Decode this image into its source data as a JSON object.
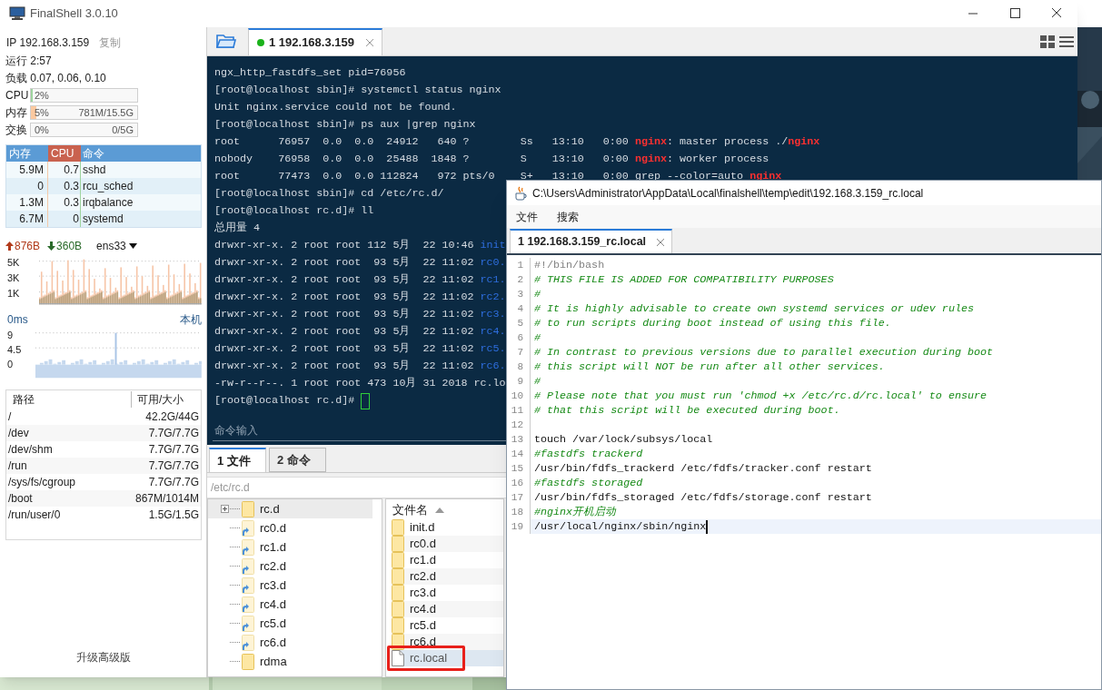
{
  "window": {
    "title": "FinalShell 3.0.10"
  },
  "sidebar": {
    "ip": "IP 192.168.3.159",
    "copy": "复制",
    "uptime": "运行 2:57",
    "load": "负载 0.07, 0.06, 0.10",
    "meters": [
      {
        "kind": "cpu",
        "label": "CPU",
        "reading": "2%",
        "level": 0.02
      },
      {
        "kind": "mem",
        "label": "内存",
        "reading": "5%",
        "detail": "781M/15.5G",
        "level": 0.05
      },
      {
        "kind": "swap",
        "label": "交换",
        "reading": "0%",
        "detail": "0/5G",
        "level": 0
      }
    ],
    "processes": {
      "columns": [
        "内存",
        "CPU",
        "命令"
      ],
      "rows": [
        [
          "5.9M",
          "0.7",
          "sshd"
        ],
        [
          "0",
          "0.3",
          "rcu_sched"
        ],
        [
          "1.3M",
          "0.3",
          "irqbalance"
        ],
        [
          "6.7M",
          "0",
          "systemd"
        ]
      ]
    },
    "network": {
      "up": "876B",
      "down": "360B",
      "interface": "ens33",
      "yticks": [
        "5K",
        "3K",
        "1K"
      ]
    },
    "latency": {
      "value": "0ms",
      "host": "本机",
      "yticks": [
        "9",
        "4.5",
        "0"
      ]
    },
    "disks": {
      "columns": [
        "路径",
        "可用/大小"
      ],
      "rows": [
        [
          "/",
          "42.2G/44G"
        ],
        [
          "/dev",
          "7.7G/7.7G"
        ],
        [
          "/dev/shm",
          "7.7G/7.7G"
        ],
        [
          "/run",
          "7.7G/7.7G"
        ],
        [
          "/sys/fs/cgroup",
          "7.7G/7.7G"
        ],
        [
          "/boot",
          "867M/1014M"
        ],
        [
          "/run/user/0",
          "1.5G/1.5G"
        ]
      ]
    },
    "upgrade": "升级高级版"
  },
  "session_tabs": [
    {
      "label": "1 192.168.3.159",
      "connected": true,
      "selected": true
    }
  ],
  "terminal": {
    "lines": [
      {
        "segments": [
          {
            "kind": "plain",
            "text": "ngx_http_fastdfs_set pid=76956"
          }
        ]
      },
      {
        "segments": [
          {
            "kind": "plain",
            "text": "[root@localhost sbin]# systemctl status nginx"
          }
        ]
      },
      {
        "segments": [
          {
            "kind": "plain",
            "text": "Unit nginx.service could not be found."
          }
        ]
      },
      {
        "segments": [
          {
            "kind": "plain",
            "text": "[root@localhost sbin]# ps aux |grep nginx"
          }
        ]
      },
      {
        "segments": [
          {
            "kind": "plain",
            "text": "root      76957  0.0  0.0  24912   640 ?        Ss   13:10   0:00 "
          },
          {
            "kind": "red",
            "text": "nginx"
          },
          {
            "kind": "plain",
            "text": ": master process ./"
          },
          {
            "kind": "red",
            "text": "nginx"
          }
        ]
      },
      {
        "segments": [
          {
            "kind": "plain",
            "text": "nobody    76958  0.0  0.0  25488  1848 ?        S    13:10   0:00 "
          },
          {
            "kind": "red",
            "text": "nginx"
          },
          {
            "kind": "plain",
            "text": ": worker process"
          }
        ]
      },
      {
        "segments": [
          {
            "kind": "plain",
            "text": "root      77473  0.0  0.0 112824   972 pts/0    S+   13:10   0:00 grep --color=auto "
          },
          {
            "kind": "red",
            "text": "nginx"
          }
        ]
      },
      {
        "segments": [
          {
            "kind": "plain",
            "text": "[root@localhost sbin]# cd /etc/rc.d/"
          }
        ]
      },
      {
        "segments": [
          {
            "kind": "plain",
            "text": "[root@localhost rc.d]# ll"
          }
        ]
      },
      {
        "segments": [
          {
            "kind": "plain",
            "text": "总用量 4"
          }
        ]
      },
      {
        "segments": [
          {
            "kind": "plain",
            "text": "drwxr-xr-x. 2 root root 112 5月  22 10:46 "
          },
          {
            "kind": "blue",
            "text": "init"
          }
        ]
      },
      {
        "segments": [
          {
            "kind": "plain",
            "text": "drwxr-xr-x. 2 root root  93 5月  22 11:02 "
          },
          {
            "kind": "blue",
            "text": "rc0."
          }
        ]
      },
      {
        "segments": [
          {
            "kind": "plain",
            "text": "drwxr-xr-x. 2 root root  93 5月  22 11:02 "
          },
          {
            "kind": "blue",
            "text": "rc1."
          }
        ]
      },
      {
        "segments": [
          {
            "kind": "plain",
            "text": "drwxr-xr-x. 2 root root  93 5月  22 11:02 "
          },
          {
            "kind": "blue",
            "text": "rc2."
          }
        ]
      },
      {
        "segments": [
          {
            "kind": "plain",
            "text": "drwxr-xr-x. 2 root root  93 5月  22 11:02 "
          },
          {
            "kind": "blue",
            "text": "rc3."
          }
        ]
      },
      {
        "segments": [
          {
            "kind": "plain",
            "text": "drwxr-xr-x. 2 root root  93 5月  22 11:02 "
          },
          {
            "kind": "blue",
            "text": "rc4."
          }
        ]
      },
      {
        "segments": [
          {
            "kind": "plain",
            "text": "drwxr-xr-x. 2 root root  93 5月  22 11:02 "
          },
          {
            "kind": "blue",
            "text": "rc5."
          }
        ]
      },
      {
        "segments": [
          {
            "kind": "plain",
            "text": "drwxr-xr-x. 2 root root  93 5月  22 11:02 "
          },
          {
            "kind": "blue",
            "text": "rc6."
          }
        ]
      },
      {
        "segments": [
          {
            "kind": "plain",
            "text": "-rw-r--r--. 1 root root 473 10月 31 2018 rc.lo"
          }
        ]
      },
      {
        "segments": [
          {
            "kind": "plain",
            "text": "[root@localhost rc.d]# "
          }
        ]
      }
    ],
    "input_placeholder": "命令输入"
  },
  "bottom_tabs": [
    {
      "label": "1 文件",
      "selected": true
    },
    {
      "label": "2 命令",
      "selected": false
    }
  ],
  "path": "/etc/rc.d",
  "tree": [
    {
      "name": "rc.d",
      "kind": "folder",
      "expandable": true,
      "selected": true
    },
    {
      "name": "rc0.d",
      "kind": "link-folder",
      "expandable": false,
      "selected": false
    },
    {
      "name": "rc1.d",
      "kind": "link-folder",
      "expandable": false,
      "selected": false
    },
    {
      "name": "rc2.d",
      "kind": "link-folder",
      "expandable": false,
      "selected": false
    },
    {
      "name": "rc3.d",
      "kind": "link-folder",
      "expandable": false,
      "selected": false
    },
    {
      "name": "rc4.d",
      "kind": "link-folder",
      "expandable": false,
      "selected": false
    },
    {
      "name": "rc5.d",
      "kind": "link-folder",
      "expandable": false,
      "selected": false
    },
    {
      "name": "rc6.d",
      "kind": "link-folder",
      "expandable": false,
      "selected": false
    },
    {
      "name": "rdma",
      "kind": "folder",
      "expandable": false,
      "selected": false
    }
  ],
  "files": {
    "column": "文件名",
    "rows": [
      {
        "name": "init.d",
        "kind": "folder",
        "selected": false,
        "marked": false
      },
      {
        "name": "rc0.d",
        "kind": "folder",
        "selected": false,
        "marked": false
      },
      {
        "name": "rc1.d",
        "kind": "folder",
        "selected": false,
        "marked": false
      },
      {
        "name": "rc2.d",
        "kind": "folder",
        "selected": false,
        "marked": false
      },
      {
        "name": "rc3.d",
        "kind": "folder",
        "selected": false,
        "marked": false
      },
      {
        "name": "rc4.d",
        "kind": "folder",
        "selected": false,
        "marked": false
      },
      {
        "name": "rc5.d",
        "kind": "folder",
        "selected": false,
        "marked": false
      },
      {
        "name": "rc6.d",
        "kind": "folder",
        "selected": false,
        "marked": false
      },
      {
        "name": "rc.local",
        "kind": "file",
        "selected": true,
        "marked": true
      }
    ]
  },
  "editor": {
    "title": "C:\\Users\\Administrator\\AppData\\Local\\finalshell\\temp\\edit\\192.168.3.159_rc.local",
    "menu": [
      "文件",
      "搜索"
    ],
    "tabs": [
      {
        "label": "1 192.168.3.159_rc.local",
        "selected": true
      }
    ],
    "lines": [
      {
        "number": "1",
        "kind": "shebang",
        "text": "#!/bin/bash",
        "current": false
      },
      {
        "number": "2",
        "kind": "comment",
        "text": "# THIS FILE IS ADDED FOR COMPATIBILITY PURPOSES",
        "current": false
      },
      {
        "number": "3",
        "kind": "comment",
        "text": "#",
        "current": false
      },
      {
        "number": "4",
        "kind": "comment",
        "text": "# It is highly advisable to create own systemd services or udev rules",
        "current": false
      },
      {
        "number": "5",
        "kind": "comment",
        "text": "# to run scripts during boot instead of using this file.",
        "current": false
      },
      {
        "number": "6",
        "kind": "comment",
        "text": "#",
        "current": false
      },
      {
        "number": "7",
        "kind": "comment",
        "text": "# In contrast to previous versions due to parallel execution during boot",
        "current": false
      },
      {
        "number": "8",
        "kind": "comment",
        "text": "# this script will NOT be run after all other services.",
        "current": false
      },
      {
        "number": "9",
        "kind": "comment",
        "text": "#",
        "current": false
      },
      {
        "number": "10",
        "kind": "comment",
        "text": "# Please note that you must run 'chmod +x /etc/rc.d/rc.local' to ensure",
        "current": false
      },
      {
        "number": "11",
        "kind": "comment",
        "text": "# that this script will be executed during boot.",
        "current": false
      },
      {
        "number": "12",
        "current": false
      },
      {
        "number": "13",
        "kind": "code",
        "text": "touch /var/lock/subsys/local",
        "current": false
      },
      {
        "number": "14",
        "kind": "comment",
        "text": "#fastdfs trackerd",
        "current": false
      },
      {
        "number": "15",
        "kind": "code",
        "text": "/usr/bin/fdfs_trackerd /etc/fdfs/tracker.conf restart",
        "current": false
      },
      {
        "number": "16",
        "kind": "comment",
        "text": "#fastdfs storaged",
        "current": false
      },
      {
        "number": "17",
        "kind": "code",
        "text": "/usr/bin/fdfs_storaged /etc/fdfs/storage.conf restart",
        "current": false
      },
      {
        "number": "18",
        "kind": "comment",
        "text": "#nginx开机启动",
        "current": false
      },
      {
        "number": "19",
        "kind": "code",
        "text": "/usr/local/nginx/sbin/nginx",
        "current": true
      }
    ]
  }
}
